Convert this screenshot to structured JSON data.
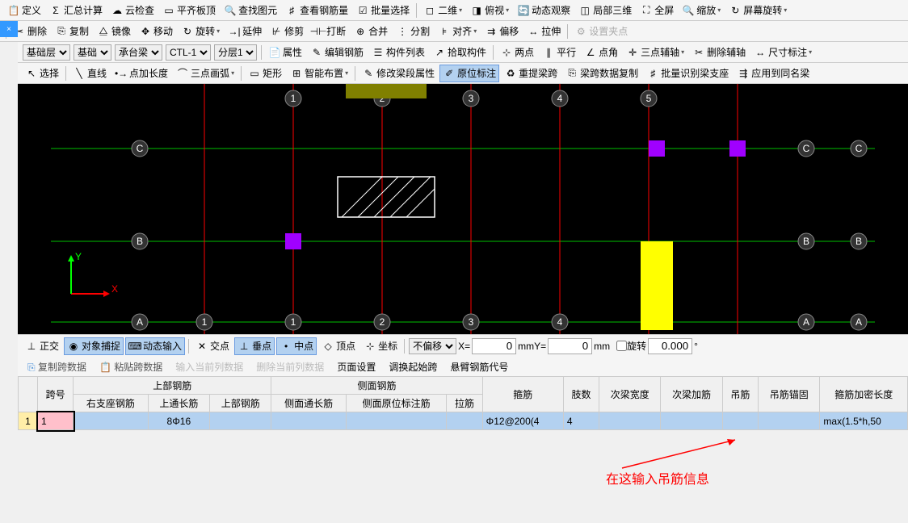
{
  "toolbar1": {
    "define": "定义",
    "summary": "汇总计算",
    "cloud": "云检查",
    "level": "平齐板顶",
    "find": "查找图元",
    "qty": "查看钢筋量",
    "batch": "批量选择",
    "2d": "二维",
    "top": "俯视",
    "dyn": "动态观察",
    "local3d": "局部三维",
    "full": "全屏",
    "zoom": "缩放",
    "rotate": "屏幕旋转"
  },
  "toolbar2": {
    "del": "删除",
    "copy": "复制",
    "mirror": "镜像",
    "move": "移动",
    "rotate": "旋转",
    "extend": "延伸",
    "trim": "修剪",
    "break": "打断",
    "merge": "合并",
    "split": "分割",
    "align": "对齐",
    "offset": "偏移",
    "stretch": "拉伸",
    "setclamp": "设置夹点"
  },
  "toolbar3": {
    "layer": "基础层",
    "member": "基础",
    "sub": "承台梁",
    "code": "CTL-1",
    "floor": "分层1",
    "attr": "属性",
    "editrebar": "编辑钢筋",
    "memlist": "构件列表",
    "pick": "拾取构件",
    "two": "两点",
    "parallel": "平行",
    "angle": "点角",
    "threeaxis": "三点辅轴",
    "delaxis": "删除辅轴",
    "dim": "尺寸标注"
  },
  "toolbar4": {
    "select": "选择",
    "line": "直线",
    "ptlen": "点加长度",
    "arc3": "三点画弧",
    "rect": "矩形",
    "smart": "智能布置",
    "modspan": "修改梁段属性",
    "inplace": "原位标注",
    "relift": "重提梁跨",
    "spandata": "梁跨数据复制",
    "batchsup": "批量识别梁支座",
    "apply": "应用到同名梁"
  },
  "status": {
    "ortho": "正交",
    "snap": "对象捕捉",
    "dynin": "动态输入",
    "cross": "交点",
    "perp": "垂点",
    "mid": "中点",
    "vertex": "顶点",
    "coord": "坐标",
    "offset": "不偏移",
    "xlabel": "X=",
    "xval": "0",
    "mm": "mm",
    "ylabel": "Y=",
    "yval": "0",
    "rot": "旋转",
    "rotval": "0.000",
    "deg": "°"
  },
  "datatabs": {
    "copyspan": "复制跨数据",
    "pastespan": "粘贴跨数据",
    "inputcol": "输入当前列数据",
    "delcol": "删除当前列数据",
    "page": "页面设置",
    "swap": "调换起始跨",
    "cant": "悬臂钢筋代号"
  },
  "grid": {
    "span": "跨号",
    "top": "上部钢筋",
    "side": "侧面钢筋",
    "rightsup": "右支座钢筋",
    "topthru": "上通长筋",
    "toprebar": "上部钢筋",
    "sidethru": "侧面通长筋",
    "sideinplace": "侧面原位标注筋",
    "tie": "拉筋",
    "stirrup": "箍筋",
    "limbs": "肢数",
    "secwidth": "次梁宽度",
    "secadd": "次梁加筋",
    "hanger": "吊筋",
    "hangeranchor": "吊筋锚固",
    "denselen": "箍筋加密长度",
    "row": {
      "n": "1",
      "span": "1",
      "topthru": "8Φ16",
      "stirrup": "Φ12@200(4",
      "limbs": "4",
      "denselen": "max(1.5*h,50"
    }
  },
  "annotation": "在这输入吊筋信息"
}
